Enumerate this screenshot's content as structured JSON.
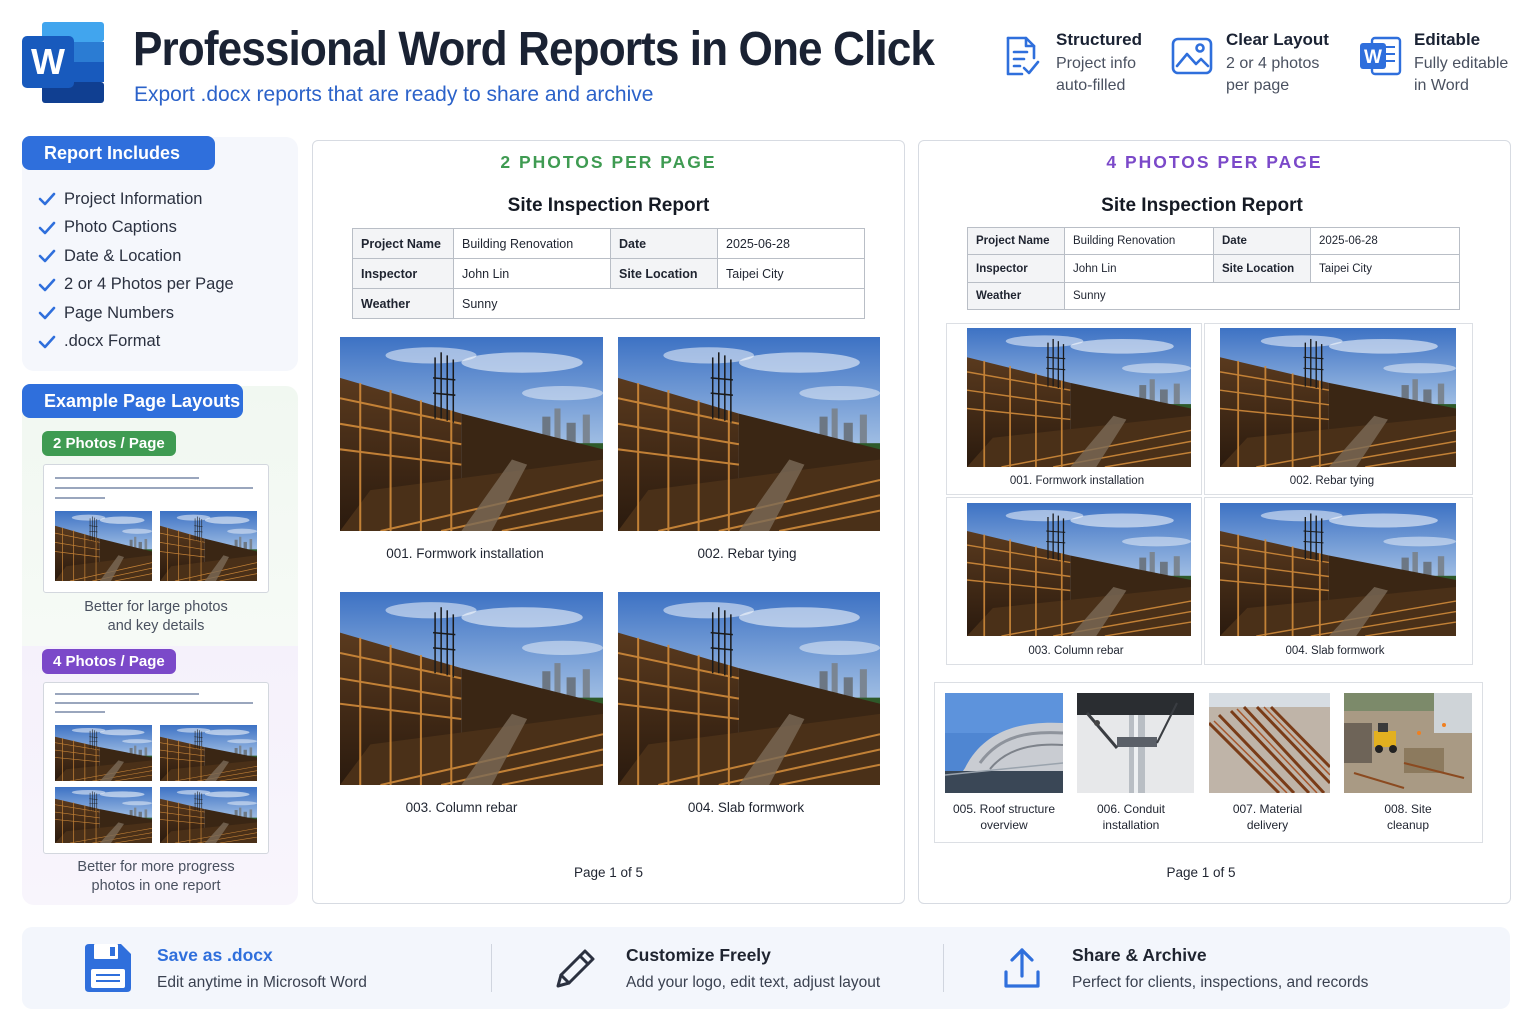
{
  "header": {
    "title": "Professional Word Reports in One Click",
    "subtitle": "Export .docx reports that are ready to share and archive",
    "logo_icon": "word-logo-icon",
    "logo_letter": "W"
  },
  "features": [
    {
      "icon": "document-check-icon",
      "title": "Structured",
      "line1": "Project info",
      "line2": "auto-filled"
    },
    {
      "icon": "image-icon",
      "title": "Clear Layout",
      "line1": "2 or 4 photos",
      "line2": "per page"
    },
    {
      "icon": "word-icon",
      "title": "Editable",
      "line1": "Fully editable",
      "line2": "in Word"
    }
  ],
  "sidebar": {
    "includes_title": "Report Includes",
    "includes": [
      "Project Information",
      "Photo Captions",
      "Date & Location",
      "2 or 4 Photos per Page",
      "Page Numbers",
      ".docx Format"
    ],
    "layouts_title": "Example Page Layouts",
    "layout_two": {
      "tag": "2 Photos / Page",
      "caption_line1": "Better for large photos",
      "caption_line2": "and key details"
    },
    "layout_four": {
      "tag": "4 Photos / Page",
      "caption_line1": "Better for more progress",
      "caption_line2": "photos in one report"
    }
  },
  "report_common": {
    "title": "Site Inspection Report",
    "labels": {
      "project_name": "Project Name",
      "date": "Date",
      "inspector": "Inspector",
      "site_location": "Site Location",
      "weather": "Weather"
    },
    "values": {
      "project_name": "Building Renovation",
      "date": "2025-06-28",
      "inspector": "John Lin",
      "site_location": "Taipei City",
      "weather": "Sunny"
    },
    "page_number": "Page 1 of 5"
  },
  "report_two": {
    "heading": "2 PHOTOS PER PAGE",
    "heading_color": "#3f9b52",
    "captions": [
      "001. Formwork installation",
      "002. Rebar tying",
      "003. Column rebar",
      "004. Slab formwork"
    ]
  },
  "report_four": {
    "heading": "4 PHOTOS PER PAGE",
    "heading_color": "#7b49c9",
    "captions": [
      "001. Formwork installation",
      "002. Rebar tying",
      "003. Column rebar",
      "004. Slab formwork"
    ],
    "small_captions": [
      {
        "line1": "005. Roof structure",
        "line2": "overview"
      },
      {
        "line1": "006. Conduit",
        "line2": "installation"
      },
      {
        "line1": "007. Material",
        "line2": "delivery"
      },
      {
        "line1": "008. Site",
        "line2": "cleanup"
      }
    ]
  },
  "bottom": [
    {
      "icon": "floppy-disk-icon",
      "title": "Save as .docx",
      "desc": "Edit anytime in Microsoft Word",
      "title_color": "#2f6fdc"
    },
    {
      "icon": "pencil-icon",
      "title": "Customize Freely",
      "desc": "Add your logo, edit text, adjust layout",
      "title_color": "#1f2430"
    },
    {
      "icon": "upload-icon",
      "title": "Share & Archive",
      "desc": "Perfect for clients, inspections, and records",
      "title_color": "#1f2430"
    }
  ],
  "colors": {
    "accent": "#2f6fdc",
    "green": "#3f9b52",
    "purple": "#7b49c9",
    "title": "#1a2233"
  }
}
